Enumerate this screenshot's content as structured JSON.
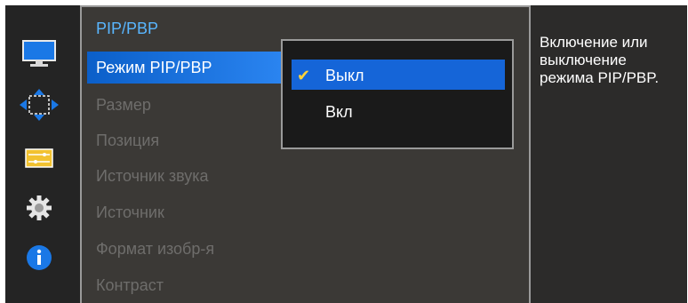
{
  "colors": {
    "accent": "#2a84f0",
    "title": "#59b6ff",
    "check": "#ffd33a",
    "disabled_text": "#6e6d6b"
  },
  "icons": [
    {
      "name": "display-icon"
    },
    {
      "name": "resize-arrows-icon"
    },
    {
      "name": "sliders-icon"
    },
    {
      "name": "gear-icon"
    },
    {
      "name": "info-icon"
    }
  ],
  "menu": {
    "title": "PIP/PBP",
    "items": [
      {
        "label": "Режим PIP/PBP",
        "active": true
      },
      {
        "label": "Размер",
        "active": false
      },
      {
        "label": "Позиция",
        "active": false
      },
      {
        "label": "Источник звука",
        "active": false
      },
      {
        "label": "Источник",
        "active": false
      },
      {
        "label": "Формат изобр-я",
        "active": false
      },
      {
        "label": "Контраст",
        "active": false
      }
    ]
  },
  "popup": {
    "options": [
      {
        "label": "Выкл",
        "selected": true
      },
      {
        "label": "Вкл",
        "selected": false
      }
    ]
  },
  "help": {
    "text": "Включение или выключение режима PIP/PBP."
  }
}
